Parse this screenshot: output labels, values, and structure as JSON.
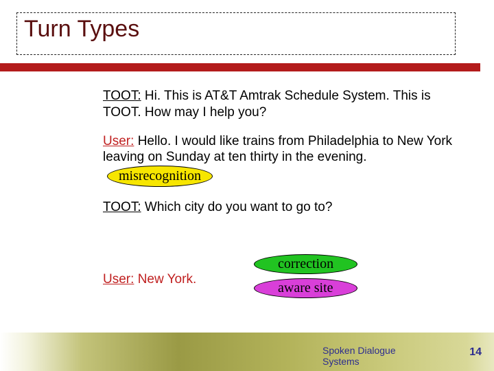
{
  "title": "Turn Types",
  "dialogue": {
    "t1": {
      "speaker": "TOOT:",
      "text": "Hi.  This is AT&T Amtrak Schedule System.  This is TOOT.  How may I help you?"
    },
    "u1": {
      "speaker": "User:",
      "text": "Hello.  I would like trains from Philadelphia to New York leaving on Sunday at ten thirty in the evening."
    },
    "t2": {
      "speaker": "TOOT:",
      "text": "Which city do you want to go to?"
    },
    "u2": {
      "speaker": "User:",
      "text": "New York."
    }
  },
  "badges": {
    "misrecognition": "misrecognition",
    "correction": "correction",
    "aware_site": "aware site"
  },
  "footer": {
    "line1": "Spoken Dialogue",
    "line2": "Systems"
  },
  "page_number": "14"
}
